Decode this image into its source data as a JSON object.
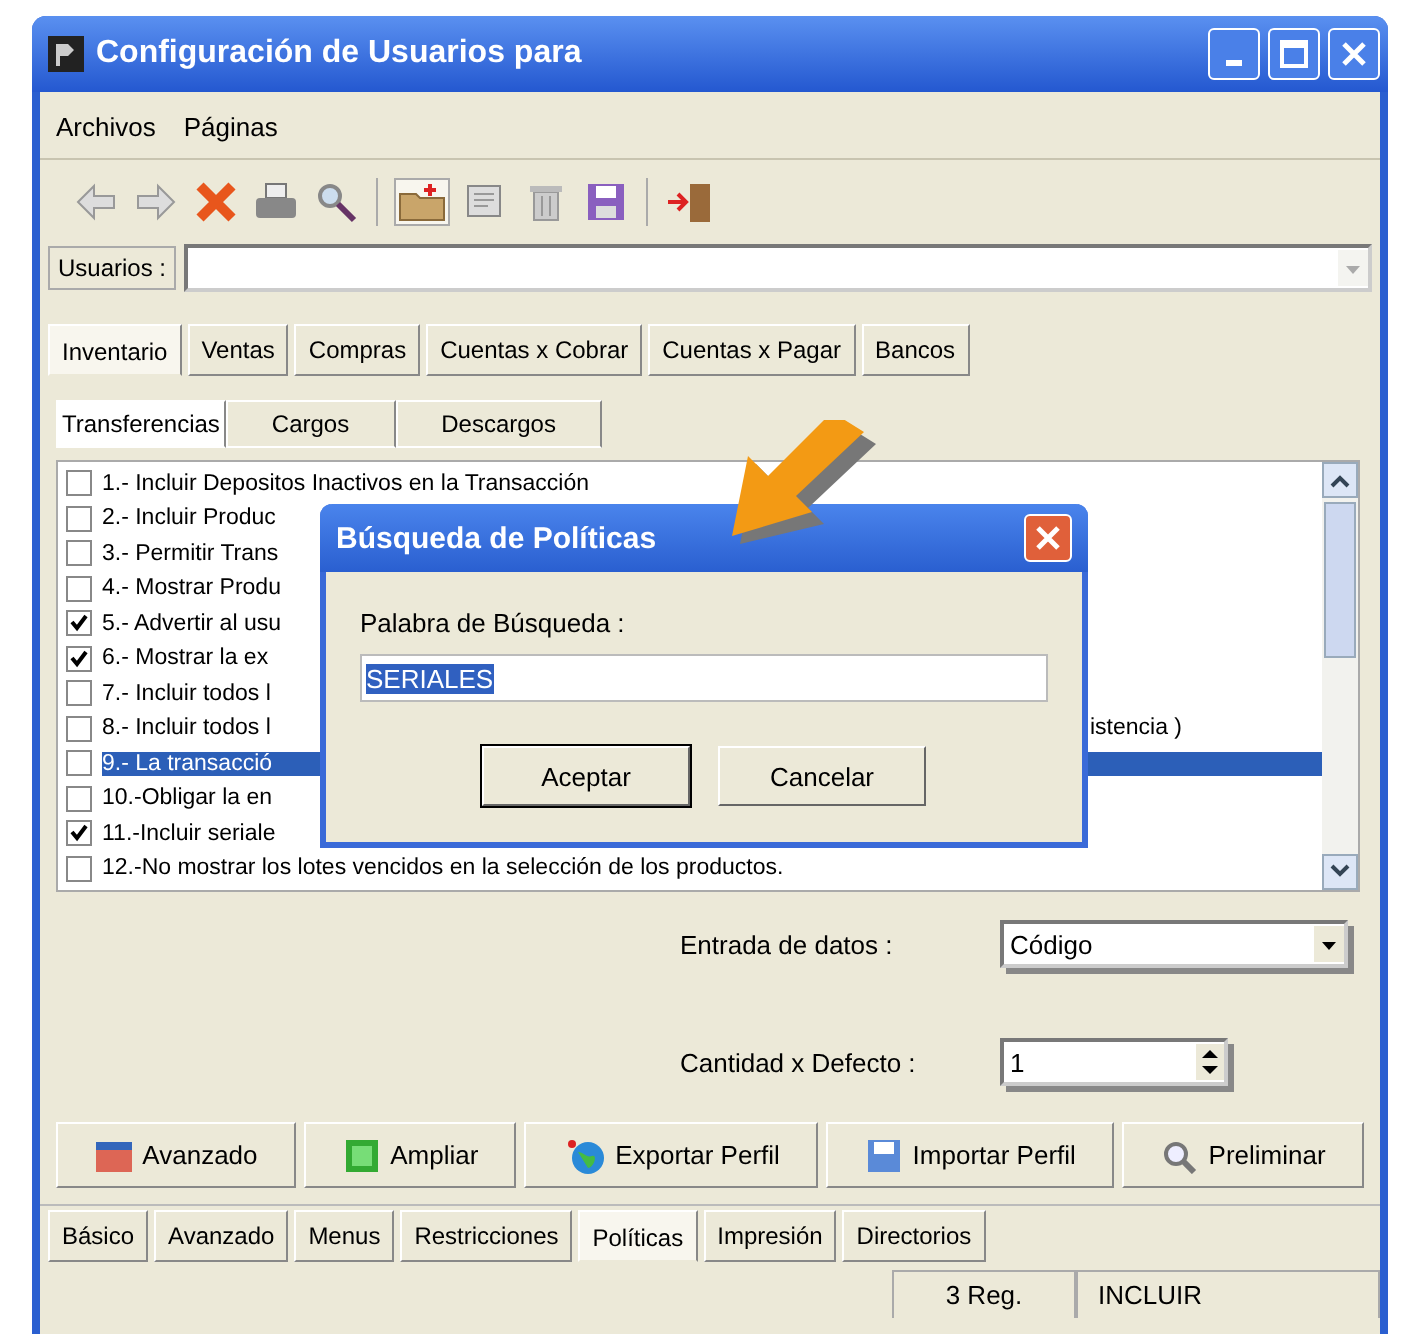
{
  "window": {
    "title": "Configuración de Usuarios para"
  },
  "menu": [
    {
      "label": "Archivos"
    },
    {
      "label": "Páginas"
    }
  ],
  "toolbar": [
    {
      "kind": "back"
    },
    {
      "kind": "forward"
    },
    {
      "kind": "delete"
    },
    {
      "kind": "print"
    },
    {
      "kind": "search"
    },
    {
      "kind": "sep"
    },
    {
      "kind": "folder"
    },
    {
      "kind": "edit"
    },
    {
      "kind": "trash"
    },
    {
      "kind": "save"
    },
    {
      "kind": "sep"
    },
    {
      "kind": "exit"
    }
  ],
  "users_field": {
    "label": "Usuarios :"
  },
  "module_tabs": [
    {
      "label": "Inventario",
      "selected": true
    },
    {
      "label": "Ventas",
      "selected": false
    },
    {
      "label": "Compras",
      "selected": false
    },
    {
      "label": "Cuentas x Cobrar",
      "selected": false
    },
    {
      "label": "Cuentas x Pagar",
      "selected": false
    },
    {
      "label": "Bancos",
      "selected": false
    }
  ],
  "sub_tabs": [
    {
      "label": "Transferencias",
      "selected": true
    },
    {
      "label": "Cargos",
      "selected": false
    },
    {
      "label": "Descargos",
      "selected": false
    }
  ],
  "policies": [
    {
      "text": "1.- Incluir Depositos Inactivos en la Transacción",
      "checked": false,
      "selected": false
    },
    {
      "text": "2.- Incluir Produc",
      "checked": false,
      "selected": false
    },
    {
      "text": "3.- Permitir Trans",
      "checked": false,
      "selected": false
    },
    {
      "text": "4.- Mostrar Produ",
      "checked": false,
      "selected": false
    },
    {
      "text": "5.- Advertir al usu",
      "checked": true,
      "selected": false
    },
    {
      "text": "6.- Mostrar  la ex",
      "checked": true,
      "selected": false
    },
    {
      "text": "7.- Incluir todos l",
      "checked": false,
      "selected": false
    },
    {
      "text": "8.- Incluir todos l",
      "tail": "istencia )",
      "checked": false,
      "selected": false
    },
    {
      "text": "9.- La transacció",
      "checked": false,
      "selected": true
    },
    {
      "text": "10.-Obligar la en",
      "checked": false,
      "selected": false
    },
    {
      "text": "11.-Incluir seriale",
      "checked": true,
      "selected": false
    },
    {
      "text": "12.-No mostrar los lotes vencidos en la selección de los productos.",
      "checked": false,
      "selected": false
    }
  ],
  "entrada": {
    "label": "Entrada de datos :",
    "value": "Código"
  },
  "cantidad": {
    "label": "Cantidad x Defecto :",
    "value": "1"
  },
  "actions": [
    {
      "label": "Avanzado",
      "kind": "advanced"
    },
    {
      "label": "Ampliar",
      "kind": "expand"
    },
    {
      "label": "Exportar Perfil",
      "kind": "export"
    },
    {
      "label": "Importar Perfil",
      "kind": "import"
    },
    {
      "label": "Preliminar",
      "kind": "preview"
    }
  ],
  "page_tabs": [
    {
      "label": "Básico",
      "selected": false
    },
    {
      "label": "Avanzado",
      "selected": false
    },
    {
      "label": "Menus",
      "selected": false
    },
    {
      "label": "Restricciones",
      "selected": false
    },
    {
      "label": "Políticas",
      "selected": true
    },
    {
      "label": "Impresión",
      "selected": false
    },
    {
      "label": "Directorios",
      "selected": false
    }
  ],
  "status_bar": {
    "count": "3 Reg.",
    "mode": "INCLUIR"
  },
  "dialog": {
    "title": "Búsqueda de Políticas",
    "label": "Palabra de Búsqueda :",
    "value": "SERIALES",
    "buttons": [
      "Aceptar",
      "Cancelar"
    ]
  }
}
